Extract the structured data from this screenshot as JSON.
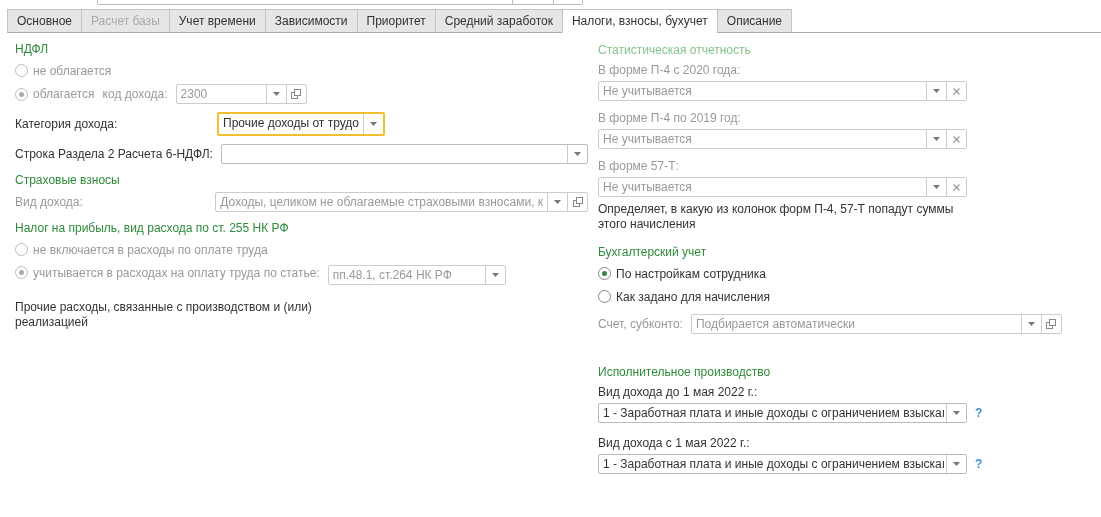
{
  "tabs": [
    {
      "label": "Основное",
      "selected": false,
      "disabled": false
    },
    {
      "label": "Расчет базы",
      "selected": false,
      "disabled": true
    },
    {
      "label": "Учет времени",
      "selected": false,
      "disabled": false
    },
    {
      "label": "Зависимости",
      "selected": false,
      "disabled": false
    },
    {
      "label": "Приоритет",
      "selected": false,
      "disabled": false
    },
    {
      "label": "Средний заработок",
      "selected": false,
      "disabled": false
    },
    {
      "label": "Налоги, взносы, бухучет",
      "selected": true,
      "disabled": false
    },
    {
      "label": "Описание",
      "selected": false,
      "disabled": false
    }
  ],
  "ndfl": {
    "title": "НДФЛ",
    "options": [
      {
        "label": "не облагается",
        "selected": false,
        "disabled": true
      },
      {
        "label": "облагается",
        "selected": true,
        "disabled": true
      }
    ],
    "code_label": "код дохода:",
    "code_value": "2300",
    "category_label": "Категория дохода:",
    "category_value": "Прочие доходы от трудо",
    "category_focused": true,
    "line_label": "Строка Раздела 2 Расчета 6-НДФЛ:"
  },
  "insurance": {
    "title": "Страховые взносы",
    "label": "Вид дохода:",
    "value": "Доходы, целиком не облагаемые страховыми взносами, к"
  },
  "profit_tax": {
    "title": "Налог на прибыль, вид расхода по ст. 255 НК РФ",
    "options": [
      {
        "label": "не включается в расходы по оплате труда",
        "selected": false,
        "disabled": true
      },
      {
        "label": "учитывается в расходах на оплату труда по статье:",
        "selected": true,
        "disabled": true
      }
    ],
    "article_value": "пп.48.1, ст.264 НК РФ",
    "note": "Прочие расходы, связанные с производством и (или) реализацией"
  },
  "statistics": {
    "title": "Статистическая отчетность",
    "disabled": true,
    "fields": [
      {
        "label": "В форме П-4 с 2020 года:",
        "value": "Не учитывается"
      },
      {
        "label": "В форме П-4 по 2019 год:",
        "value": "Не учитывается"
      },
      {
        "label": "В форме 57-Т:",
        "value": "Не учитывается"
      }
    ],
    "note": "Определяет, в какую из колонок форм П-4, 57-Т попадут суммы этого начисления"
  },
  "accounting": {
    "title": "Бухгалтерский учет",
    "options": [
      {
        "label": "По настройкам сотрудника",
        "selected": true,
        "disabled": false
      },
      {
        "label": "Как задано для начисления",
        "selected": false,
        "disabled": false
      }
    ],
    "account_label": "Счет, субконто:",
    "account_value": "Подбирается автоматически"
  },
  "enforcement": {
    "title": "Исполнительное производство",
    "fields": [
      {
        "label": "Вид дохода до 1 мая 2022 г.:",
        "value": "1 - Заработная плата и иные доходы с ограничением взыскаı",
        "help": "?"
      },
      {
        "label": "Вид дохода с 1 мая 2022 г.:",
        "value": "1 - Заработная плата и иные доходы с ограничением взыскаı",
        "help": "?"
      }
    ]
  }
}
